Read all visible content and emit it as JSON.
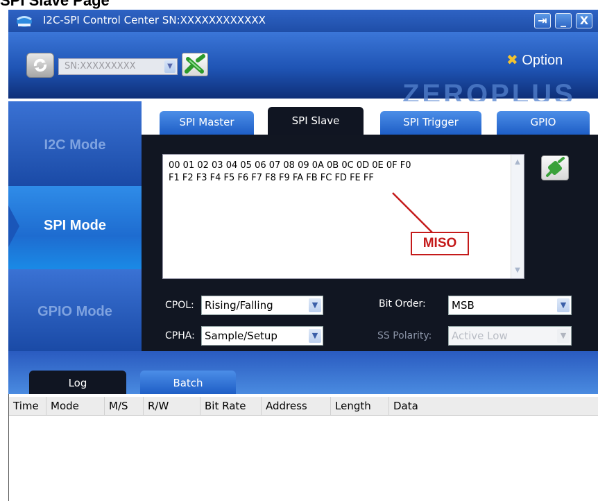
{
  "page_heading": "SPI Slave Page",
  "window": {
    "title": "I2C-SPI Control Center SN:XXXXXXXXXXXX",
    "controls": {
      "pin": "⇥",
      "minimize": "_",
      "close": "X"
    }
  },
  "header": {
    "sn_selected": "SN:XXXXXXXXX",
    "option_label": "Option",
    "brand": "ZEROPLUS"
  },
  "modes": [
    "I2C Mode",
    "SPI Mode",
    "GPIO Mode"
  ],
  "active_mode": "SPI Mode",
  "tabs": [
    "SPI Master",
    "SPI Slave",
    "SPI Trigger",
    "GPIO"
  ],
  "active_tab": "SPI Slave",
  "slave_data": {
    "lines": [
      "00 01 02 03 04 05 06 07 08 09 0A 0B 0C 0D 0E 0F F0",
      "F1 F2 F3 F4 F5 F6 F7 F8 F9 FA FB FC FD FE FF"
    ],
    "annotation": "MISO"
  },
  "settings": {
    "cpol": {
      "label": "CPOL:",
      "value": "Rising/Falling"
    },
    "cpha": {
      "label": "CPHA:",
      "value": "Sample/Setup"
    },
    "bit_order": {
      "label": "Bit Order:",
      "value": "MSB"
    },
    "ss_polarity": {
      "label": "SS Polarity:",
      "value": "Active Low"
    }
  },
  "bottom_tabs": [
    "Log",
    "Batch"
  ],
  "log_columns": [
    "Time",
    "Mode",
    "M/S",
    "R/W",
    "Bit Rate",
    "Address",
    "Length",
    "Data"
  ],
  "colors": {
    "accent_blue": "#1f54b4",
    "panel_dark": "#111622",
    "annotation_red": "#c41a1a"
  }
}
